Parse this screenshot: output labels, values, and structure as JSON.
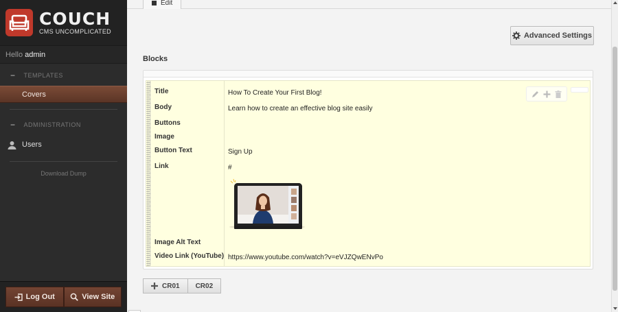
{
  "brand": {
    "title": "COUCH",
    "subtitle": "CMS UNCOMPLICATED"
  },
  "sidebar": {
    "hello_prefix": "Hello",
    "user": "admin",
    "sections": [
      {
        "title": "TEMPLATES",
        "items": [
          {
            "label": "Covers",
            "active": true
          }
        ]
      },
      {
        "title": "ADMINISTRATION",
        "items": [
          {
            "label": "Users",
            "active": false
          }
        ]
      }
    ],
    "download_dump": "Download Dump",
    "logout_label": "Log Out",
    "view_site_label": "View Site"
  },
  "main": {
    "tab_label": "Edit",
    "advanced_settings_label": "Advanced Settings",
    "blocks_label": "Blocks",
    "block": {
      "fields": [
        {
          "label": "Title",
          "value": "How To Create Your First Blog!"
        },
        {
          "label": "Body",
          "value": "Learn how to create an effective blog site easily"
        },
        {
          "label": "Buttons",
          "value": ""
        },
        {
          "label": "Image",
          "value": ""
        },
        {
          "label": "Button Text",
          "value": "Sign Up"
        },
        {
          "label": "Link",
          "value": "#"
        },
        {
          "label": "Image Alt Text",
          "value": ""
        },
        {
          "label": "Video Link (YouTube)",
          "value": "https://www.youtube.com/watch?v=eVJZQwENvPo"
        }
      ]
    },
    "add_buttons": [
      "CR01",
      "CR02"
    ]
  },
  "colors": {
    "sidebar_bg": "#2c2c2c",
    "accent_brown": "#6b3d2c",
    "logo_red": "#c0392b",
    "block_bg": "#ffffe0"
  }
}
